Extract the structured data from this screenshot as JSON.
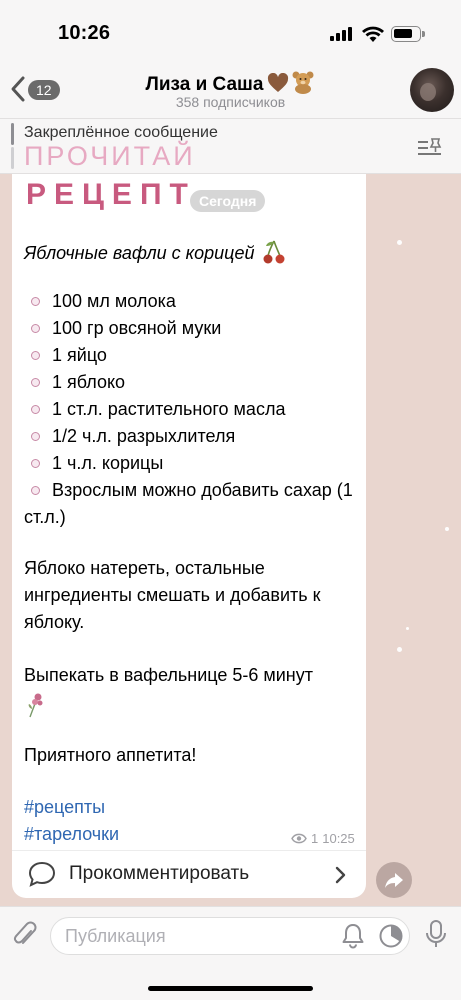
{
  "status_bar": {
    "time": "10:26"
  },
  "header": {
    "back_badge": "12",
    "title": "Лиза и Саша",
    "subtitle": "358 подписчиков"
  },
  "pinned": {
    "label": "Закреплённое сообщение",
    "text": "ПРОЧИТАЙ"
  },
  "message": {
    "heading": "РЕЦЕПТ",
    "date_label": "Сегодня",
    "title": "Яблочные вафли с корицей",
    "ingredients": [
      "100 мл молока",
      "100 гр овсяной муки",
      "1 яйцо",
      "1 яблоко",
      "1 ст.л. растительного масла",
      "1/2 ч.л. разрыхлителя",
      "1 ч.л. корицы",
      "Взрослым можно добавить сахар (1 ст.л.)"
    ],
    "step1": "Яблоко натереть, остальные ингредиенты смешать и добавить к яблоку.",
    "step2": "Выпекать в вафельнице 5-6 минут",
    "closing": "Приятного аппетита!",
    "hashtags": [
      "#рецепты",
      "#тарелочки"
    ],
    "views": "1",
    "time": "10:25"
  },
  "comments": {
    "label": "Прокомментировать"
  },
  "input": {
    "placeholder": "Публикация"
  },
  "colors": {
    "chat_background": "#e9d6cf",
    "heading_pink": "#c85a7f",
    "pinned_pink": "#e7a9c2",
    "hashtag_blue": "#2f67b2"
  },
  "icons": [
    "back-chevron-icon",
    "heart-icon",
    "bear-icon",
    "pin-list-icon",
    "cherry-icon",
    "flower-icon",
    "eye-icon",
    "comment-icon",
    "chevron-right-icon",
    "share-icon",
    "attach-icon",
    "bell-icon",
    "timer-icon",
    "mic-icon"
  ]
}
